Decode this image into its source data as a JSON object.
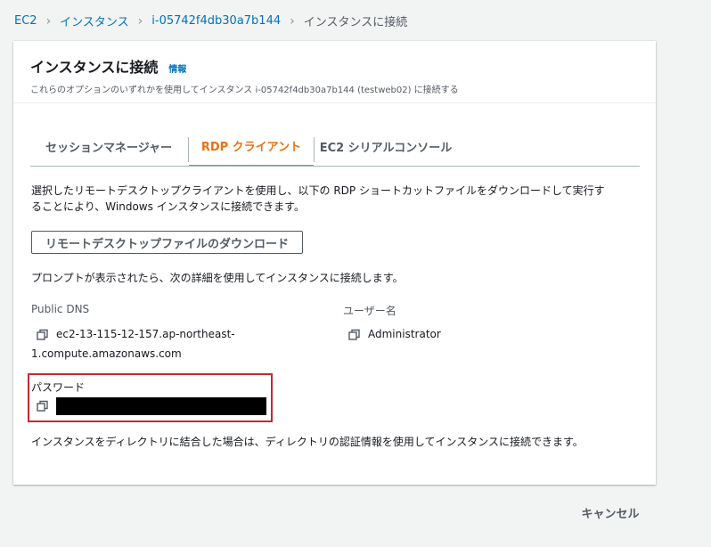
{
  "breadcrumb": {
    "items": [
      "EC2",
      "インスタンス",
      "i-05742f4db30a7b144"
    ],
    "current": "インスタンスに接続"
  },
  "header": {
    "title": "インスタンスに接続",
    "info": "情報",
    "description": "これらのオプションのいずれかを使用してインスタンス i-05742f4db30a7b144 (testweb02) に接続する"
  },
  "tabs": [
    {
      "label": "セッションマネージャー",
      "active": false
    },
    {
      "label": "RDP クライアント",
      "active": true
    },
    {
      "label": "EC2 シリアルコンソール",
      "active": false
    }
  ],
  "rdp": {
    "intro_line1": "選択したリモートデスクトップクライアントを使用し、以下の RDP ショートカットファイルをダウンロードして実行す",
    "intro_line2": "ることにより、Windows インスタンスに接続できます。",
    "download_button": "リモートデスクトップファイルのダウンロード",
    "prompt_text": "プロンプトが表示されたら、次の詳細を使用してインスタンスに接続します。",
    "public_dns_label": "Public DNS",
    "public_dns_line1": "ec2-13-115-12-157.ap-northeast-",
    "public_dns_line2": "1.compute.amazonaws.com",
    "username_label": "ユーザー名",
    "username_value": "Administrator",
    "password_label": "パスワード",
    "footer_text": "インスタンスをディレクトリに結合した場合は、ディレクトリの認証情報を使用してインスタンスに接続できます。"
  },
  "actions": {
    "cancel": "キャンセル"
  },
  "colors": {
    "link": "#0073bb",
    "active_tab": "#ec7211",
    "highlight_border": "#c7282d",
    "background": "#f2f3f3"
  },
  "icons": {
    "separator": "chevron-right-icon",
    "copy": "copy-icon"
  }
}
